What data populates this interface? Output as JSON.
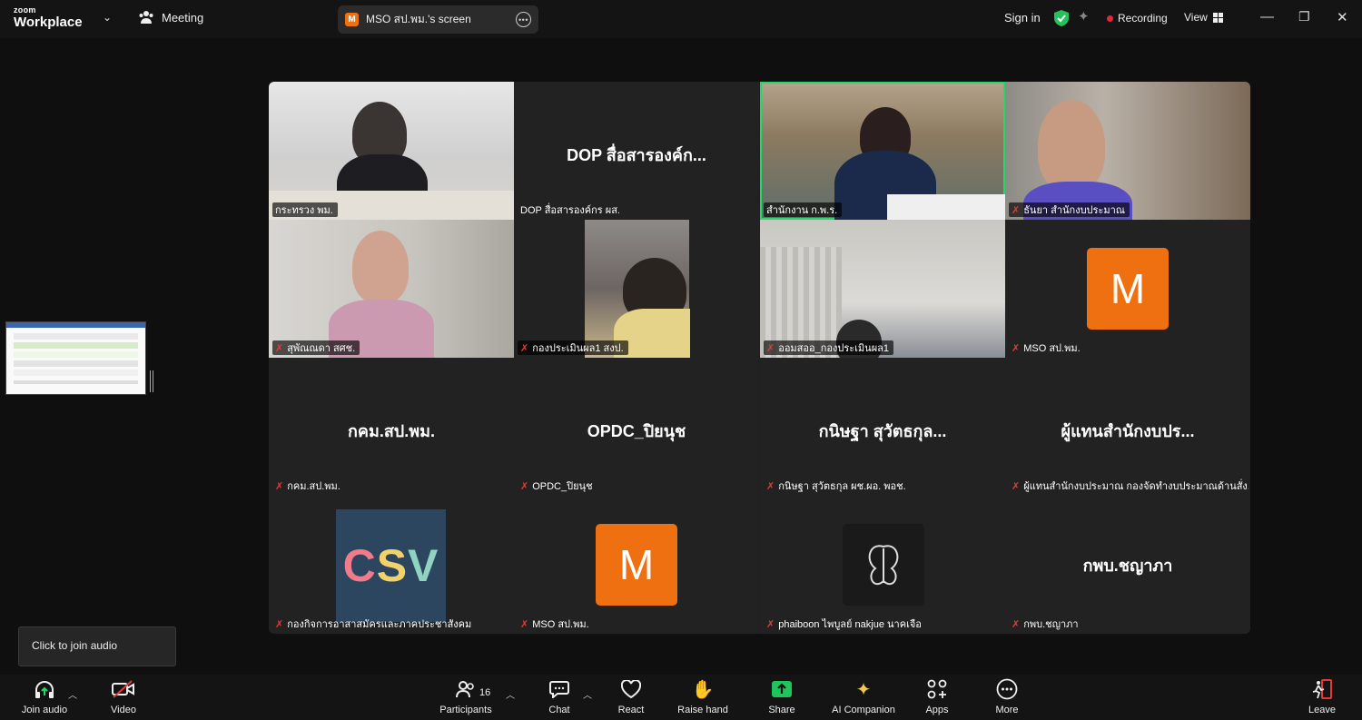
{
  "topbar": {
    "logo_small": "zoom",
    "logo_big": "Workplace",
    "meeting_label": "Meeting",
    "share_badge": "M",
    "share_title": "MSO สป.พม.'s screen",
    "sign_in": "Sign in",
    "recording": "Recording",
    "view": "View"
  },
  "colors": {
    "accent_green": "#23d96a",
    "avatar_orange": "#ef7010",
    "record_red": "#e8263a"
  },
  "tiles": [
    {
      "label": "กระทรวง พม.",
      "muted": false
    },
    {
      "center": "DOP สื่อสารองค์ก...",
      "label": "DOP สื่อสารองค์กร ผส.",
      "muted": false
    },
    {
      "label": "สำนักงาน ก.พ.ร.",
      "muted": false,
      "active": true
    },
    {
      "label": "ธันยา สำนักงบประมาณ",
      "muted": true
    },
    {
      "label": "สุพัณณดา สศช.",
      "muted": true
    },
    {
      "label": "กองประเมินผล1 สงป.",
      "muted": true
    },
    {
      "label": "ออมสออ_กองประเมินผล1",
      "muted": true
    },
    {
      "avatar": "M",
      "label": "MSO สป.พม.",
      "muted": true
    },
    {
      "center": "กคม.สป.พม.",
      "label": "กคม.สป.พม.",
      "muted": true
    },
    {
      "center": "OPDC_ปิยนุช",
      "label": "OPDC_ปิยนุช",
      "muted": true
    },
    {
      "center": "กนิษฐา สุวัตธกุล...",
      "label": "กนิษฐา สุวัตธกุล  ผช.ผอ. พอช.",
      "muted": true
    },
    {
      "center": "ผู้แทนสำนักงบปร...",
      "label": "ผู้แทนสำนักงบประมาณ กองจัดทำงบประมาณด้านสั่ง...",
      "muted": true
    },
    {
      "logo": "CSV",
      "label": "กองกิจการอาสาสมัครและภาคประชาสังคม",
      "muted": true
    },
    {
      "avatar": "M",
      "label": "MSO สป.พม.",
      "muted": true
    },
    {
      "label": "phaiboon ไพบูลย์ nakjue นาคเจือ",
      "muted": true
    },
    {
      "center": "กพบ.ชญาภา",
      "label": "กพบ.ชญาภา",
      "muted": true
    }
  ],
  "tooltip": "Click to join audio",
  "toolbar": {
    "join_audio": "Join audio",
    "video": "Video",
    "participants": "Participants",
    "participants_count": "16",
    "chat": "Chat",
    "react": "React",
    "raise_hand": "Raise hand",
    "share": "Share",
    "ai_companion": "AI Companion",
    "apps": "Apps",
    "more": "More",
    "leave": "Leave"
  }
}
